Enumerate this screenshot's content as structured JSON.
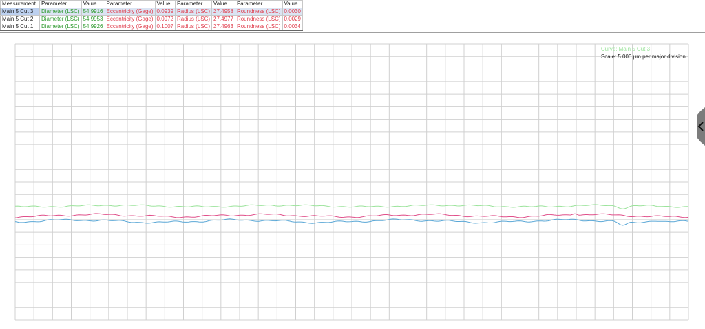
{
  "table": {
    "headers": [
      "Measurement",
      "Parameter",
      "Value",
      "Parameter",
      "Value",
      "Parameter",
      "Value",
      "Parameter",
      "Value"
    ],
    "rows": [
      {
        "measurement": "Main 5 Cut 3",
        "p1": "Diameter (LSC)",
        "v1": "54.9916",
        "p2": "Eccentricity (Gage)",
        "v2": "0.0939",
        "p3": "Radius (LSC)",
        "v3": "27.4958",
        "p4": "Roundness (LSC)",
        "v4": "0.0030"
      },
      {
        "measurement": "Main 5 Cut 2",
        "p1": "Diameter (LSC)",
        "v1": "54.9953",
        "p2": "Eccentricity (Gage)",
        "v2": "0.0972",
        "p3": "Radius (LSC)",
        "v3": "27.4977",
        "p4": "Roundness (LSC)",
        "v4": "0.0029"
      },
      {
        "measurement": "Main 5 Cut 1",
        "p1": "Diameter (LSC)",
        "v1": "54.9926",
        "p2": "Eccentricity (Gage)",
        "v2": "0.1007",
        "p3": "Radius (LSC)",
        "v3": "27.4963",
        "p4": "Roundness (LSC)",
        "v4": "0.0034"
      }
    ]
  },
  "legend": {
    "curve": "Curve: Main 5 Cut 3",
    "scale": "Scale: 5.000 μm per major division."
  },
  "icons": {
    "side_tab": "chevron-left-icon"
  },
  "colors": {
    "cut3": "#9be39b",
    "cut2": "#e0508a",
    "cut1": "#5aa7d6",
    "grid": "#d0d0d0"
  }
}
